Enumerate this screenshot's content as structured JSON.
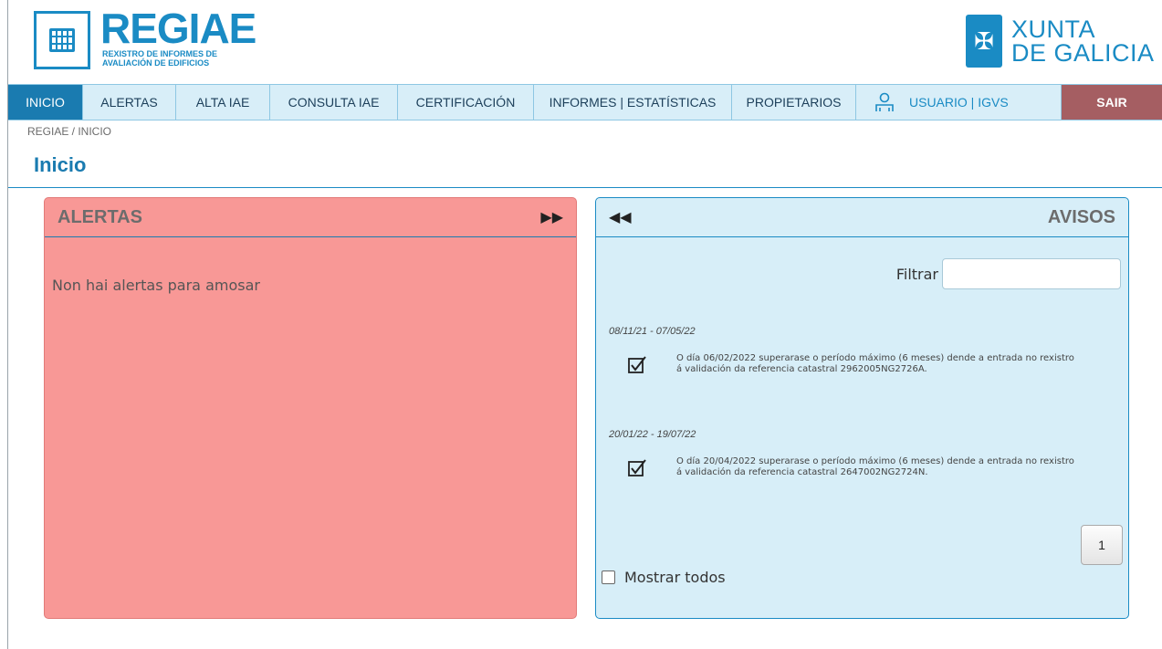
{
  "header": {
    "brand_title": "REGIAE",
    "brand_subtitle_line1": "REXISTRO DE INFORMES DE",
    "brand_subtitle_line2": "AVALIACIÓN DE EDIFICIOS",
    "xunta_line1": "XUNTA",
    "xunta_line2": "DE GALICIA"
  },
  "nav": {
    "items": [
      {
        "label": "INICIO",
        "active": true
      },
      {
        "label": "ALERTAS"
      },
      {
        "label": "ALTA IAE"
      },
      {
        "label": "CONSULTA IAE"
      },
      {
        "label": "CERTIFICACIÓN"
      },
      {
        "label": "INFORMES | ESTATÍSTICAS"
      },
      {
        "label": "PROPIETARIOS"
      }
    ],
    "user_label": "USUARIO | IGVS",
    "exit_label": "SAIR"
  },
  "breadcrumb": "REGIAE / INICIO",
  "page_title": "Inicio",
  "alertas": {
    "title": "ALERTAS",
    "empty_message": "Non hai alertas para amosar"
  },
  "avisos": {
    "title": "AVISOS",
    "filter_label": "Filtrar",
    "notices": [
      {
        "date_range": "08/11/21 - 07/05/22",
        "text": "O día 06/02/2022 superarase o período máximo (6 meses) dende a entrada no rexistro á validación da referencia catastral 2962005NG2726A."
      },
      {
        "date_range": "20/01/22 - 19/07/22",
        "text": "O día 20/04/2022 superarase o período máximo (6 meses) dende a entrada no rexistro á validación da referencia catastral 2647002NG2724N."
      }
    ],
    "page_number": "1",
    "show_all_label": "Mostrar todos"
  },
  "colors": {
    "primary": "#1a8bc4",
    "nav_active": "#1a7bb0",
    "nav_bg": "#d8eef8",
    "exit_bg": "#a55e62",
    "alertas_bg": "#f89896",
    "avisos_bg": "#d7eef8"
  }
}
